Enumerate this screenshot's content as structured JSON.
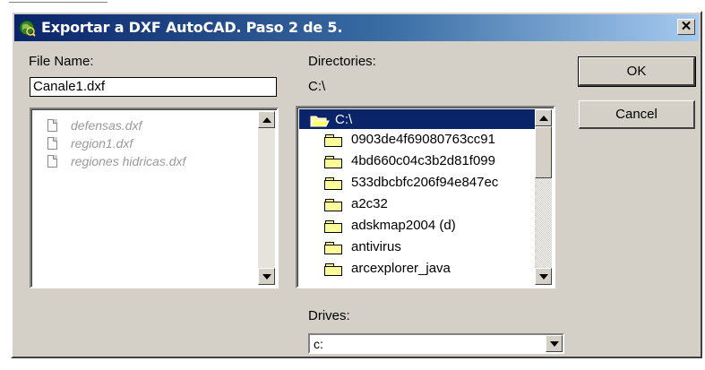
{
  "window": {
    "title": "Exportar a DXF AutoCAD. Paso 2 de 5.",
    "close_symbol": "✕"
  },
  "file_name": {
    "label": "File Name:",
    "value": "Canale1.dxf"
  },
  "files": [
    {
      "name": "defensas.dxf",
      "icon": "document-icon"
    },
    {
      "name": "region1.dxf",
      "icon": "document-icon"
    },
    {
      "name": "regiones hidricas.dxf",
      "icon": "document-icon"
    }
  ],
  "directories": {
    "label": "Directories:",
    "current": "C:\\",
    "items": [
      {
        "name": "C:\\",
        "icon": "open-folder-icon",
        "selected": true
      },
      {
        "name": "0903de4f69080763cc91",
        "icon": "folder-icon"
      },
      {
        "name": "4bd660c04c3b2d81f099",
        "icon": "folder-icon"
      },
      {
        "name": "533dbcbfc206f94e847ec",
        "icon": "folder-icon"
      },
      {
        "name": "a2c32",
        "icon": "folder-icon"
      },
      {
        "name": "adskmap2004 (d)",
        "icon": "folder-icon"
      },
      {
        "name": "antivirus",
        "icon": "folder-icon"
      },
      {
        "name": "arcexplorer_java",
        "icon": "folder-icon"
      }
    ]
  },
  "drives": {
    "label": "Drives:",
    "value": "c:"
  },
  "buttons": {
    "ok": "OK",
    "cancel": "Cancel"
  },
  "colors": {
    "title_start": "#0a246a",
    "title_end": "#a6caf0",
    "face": "#d4d0c8",
    "selection": "#0a246a"
  }
}
